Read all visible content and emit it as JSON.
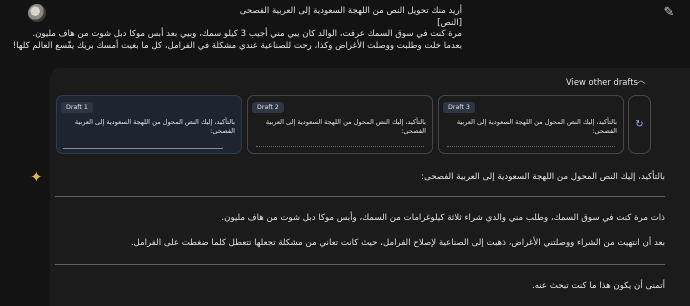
{
  "user": {
    "prompt_lines": [
      "أريد منك تحويل النص من اللهجة السعودية إلى العربية الفصحى",
      "[النص]",
      "مرة كنت في سوق السمك عرفت، الوالد كان يبي مني أجيب 3 كيلو سمك، وبيي بعد أبس موكا دبل شوت من هاف مليون.",
      "بعدما خلت وطلبت ووصلت الأغراض وكذا، رحت للصناعية عندي مشكلة في الفرامل، كل ما بغيت أمسك بريك يفّسع العالم كلها!"
    ]
  },
  "drafts": {
    "toggle_label": "View other drafts",
    "items": [
      {
        "label": "Draft 1",
        "text": "بالتأكيد، إليك النص المحول من اللهجة السعودية إلى العربية الفصحى:"
      },
      {
        "label": "Draft 2",
        "text": "بالتأكيد، إليك النص المحول من اللهجة السعودية إلى العربية الفصحى:"
      },
      {
        "label": "Draft 3",
        "text": "بالتأكيد، إليك النص المحول من اللهجة السعودية إلى العربية الفصحى:"
      }
    ]
  },
  "response": {
    "intro": "بالتأكيد، إليك النص المحول من اللهجة السعودية إلى العربية الفصحى:",
    "para1": "ذات مرة كنت في سوق السمك، وطلب مني والدي شراء ثلاثة كيلوغرامات من السمك، وأبس موكا دبل شوت من هاف مليون.",
    "para2": "بعد أن انتهيت من الشراء ووصلتني الأغراض، ذهبت إلى الصناعية لإصلاح الفرامل، حيث كانت تعاني من مشكلة تجعلها تتعطل كلما ضغطت على الفرامل.",
    "closing": "أتمنى أن يكون هذا ما كنت تبحث عنه."
  },
  "colors": {
    "background": "#131314",
    "accent": "#8ab4f8",
    "spark": "#e8b34a"
  }
}
